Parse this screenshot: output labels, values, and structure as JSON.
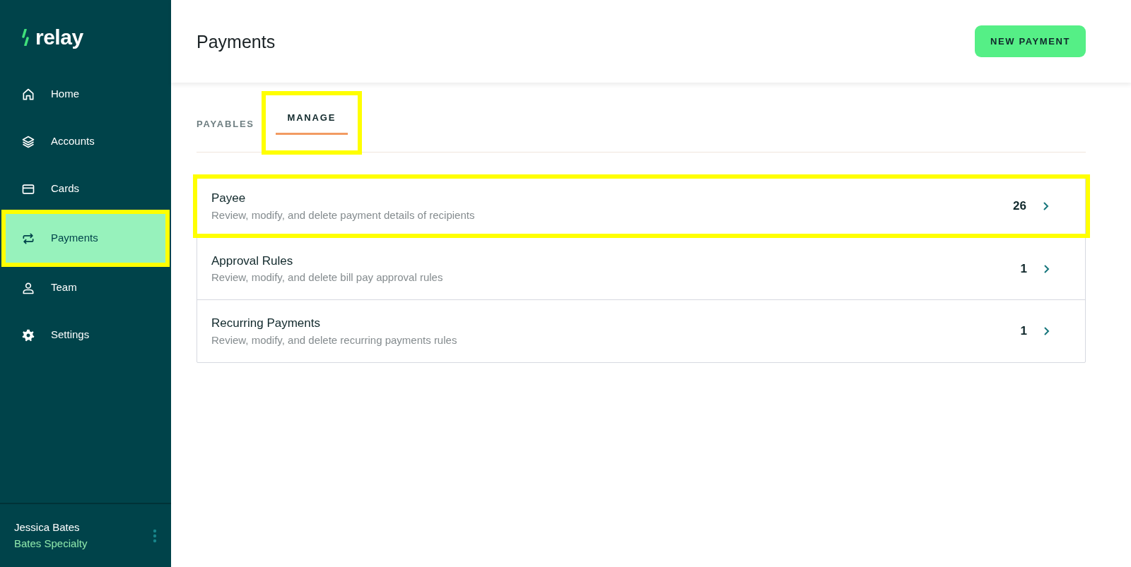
{
  "sidebar": {
    "logo": "relay",
    "items": [
      {
        "label": "Home",
        "kind": "home",
        "selected": false,
        "highlighted": false
      },
      {
        "label": "Accounts",
        "kind": "layers",
        "selected": false,
        "highlighted": false
      },
      {
        "label": "Cards",
        "kind": "card",
        "selected": false,
        "highlighted": false
      },
      {
        "label": "Payments",
        "kind": "swap",
        "selected": true,
        "highlighted": true
      },
      {
        "label": "Team",
        "kind": "person",
        "selected": false,
        "highlighted": false
      },
      {
        "label": "Settings",
        "kind": "gear",
        "selected": false,
        "highlighted": false
      }
    ],
    "user": {
      "name": "Jessica Bates",
      "company": "Bates Specialty"
    }
  },
  "header": {
    "title": "Payments",
    "button": "NEW PAYMENT"
  },
  "tabs": [
    {
      "label": "PAYABLES",
      "selected": false,
      "highlighted": false
    },
    {
      "label": "MANAGE",
      "selected": true,
      "highlighted": true
    }
  ],
  "rows": [
    {
      "title": "Payee",
      "description": "Review, modify, and delete payment details of recipients",
      "count": "26",
      "highlighted": true
    },
    {
      "title": "Approval Rules",
      "description": "Review, modify, and delete bill pay approval rules",
      "count": "1",
      "highlighted": false
    },
    {
      "title": "Recurring Payments",
      "description": "Review, modify, and delete recurring payments rules",
      "count": "1",
      "highlighted": false
    }
  ]
}
